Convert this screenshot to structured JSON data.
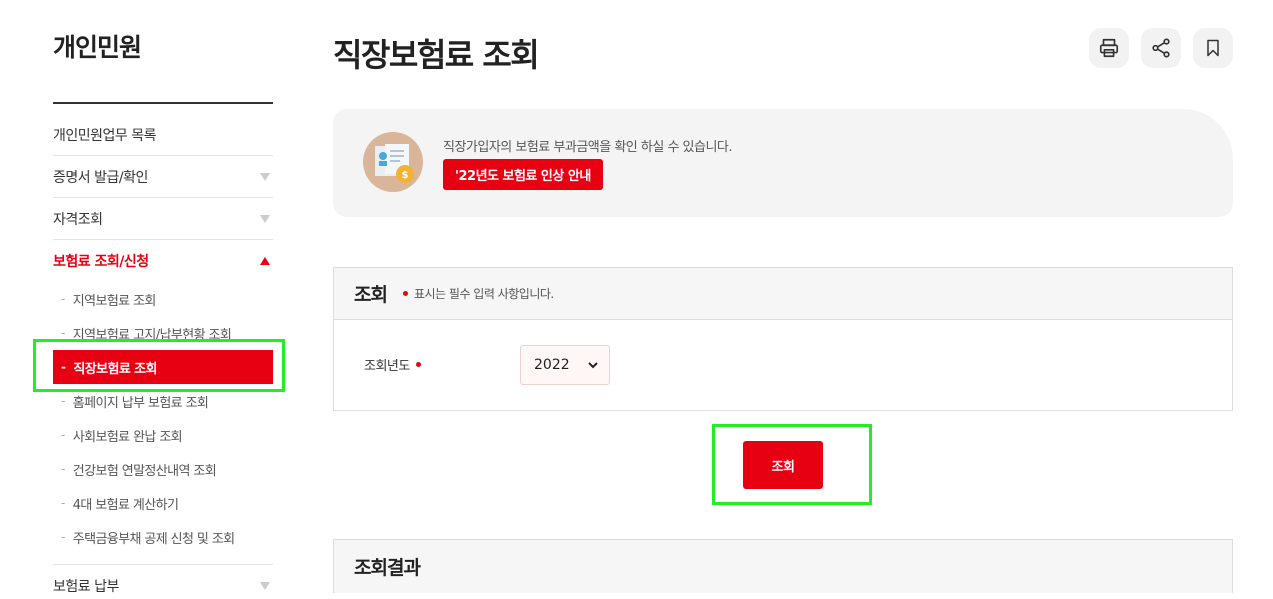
{
  "sidebar": {
    "title": "개인민원",
    "items": [
      {
        "label": "개인민원업무 목록"
      },
      {
        "label": "증명서 발급/확인"
      },
      {
        "label": "자격조회"
      },
      {
        "label": "보험료 조회/신청"
      }
    ],
    "subitems": [
      {
        "label": "지역보험료 조회"
      },
      {
        "label": "지역보험료 고지/납부현황 조회"
      },
      {
        "label": "직장보험료 조회"
      },
      {
        "label": "홈페이지 납부 보험료 조회"
      },
      {
        "label": "사회보험료 완납 조회"
      },
      {
        "label": "건강보험 연말정산내역 조회"
      },
      {
        "label": "4대 보험료 계산하기"
      },
      {
        "label": "주택금융부채 공제 신청 및 조회"
      }
    ],
    "bottom_item": {
      "label": "보험료 납부"
    },
    "dash": "-"
  },
  "main": {
    "title": "직장보험료 조회",
    "tools": [
      "print-icon",
      "share-icon",
      "bookmark-icon"
    ],
    "info": {
      "text": "직장가입자의 보험료 부과금액을 확인 하실 수 있습니다.",
      "badge": "'22년도 보험료 인상 안내"
    },
    "query": {
      "title": "조회",
      "note": "표시는 필수 입력 사항입니다.",
      "year_label": "조회년도",
      "year_value": "2022",
      "submit": "조회"
    },
    "result": {
      "title": "조회결과"
    }
  },
  "colors": {
    "accent": "#e60012",
    "highlight": "#22ee22"
  }
}
